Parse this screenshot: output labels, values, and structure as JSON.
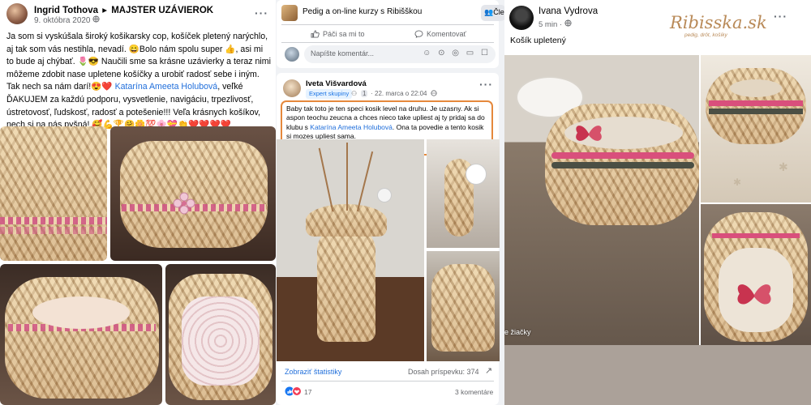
{
  "post1": {
    "author": "Ingrid Tothova",
    "arrow": "▸",
    "group": "MAJSTER UZÁVIEROK",
    "date": "9. októbra 2020",
    "text_a": "Ja som si vyskúšala široký košikarsky cop, košíček pletený narýchlo, aj tak som vás nestihla, nevadí. 😄Bolo nám spolu super 👍, asi mi to bude aj chýbať. 🌷😎 Naučili sme sa krásne uzávierky a teraz  nimi môžeme zdobit nase upletene košíčky a urobiť radosť sebe i iným. Tak nech sa nám darí!😍❤️ ",
    "link": "Katarína Ameeta Holubová",
    "text_b": ", veľké ĎAKUJEM za každú podporu, vysvetlenie, navigáciu, trpezlivosť, ústretovosť, ľudskosť, radosť a potešenie!!! Veľa krásnych košíkov, nech si na nás pyšná! 🥰💪🏆🤗🌼💯🌸💝👏❤️❤️❤️❤️"
  },
  "post2": {
    "group_name": "Pedig a on-line kurzy s Ribišškou",
    "group_btn": "Čle",
    "like_label": "Páči sa mi to",
    "comment_label": "Komentovať",
    "comment_placeholder": "Napíšte komentár...",
    "comment_icons": "☺ ⊙ ◎ ▭ ☐",
    "author": "Iveta Višvardová",
    "badge": "Expert skupiny",
    "number": "1",
    "date": "22. marca o 22:04",
    "text_a": "Baby tak toto je ten speci kosik level na druhu. Je uzasny. Ak si aspon teochu zeucna a chces nieco take upliest aj ty pridaj sa do klubu s ",
    "link": "Katarína Ameeta Holubová",
    "text_b": ". Ona ta povedie a tento kosik si mozes upliest sama.",
    "stats_label": "Zobraziť štatistiky",
    "reach_label": "Dosah príspevku: 374",
    "reactions": "17",
    "comments": "3 komentáre"
  },
  "post3": {
    "author": "Ivana Vydrova",
    "time": "5 min",
    "logo": "Ribisska.sk",
    "logo_tagline": "pedig, drôt, košíky",
    "caption": "Košík upletený",
    "overlay_text": "e žiačky"
  },
  "colors": {
    "link": "#216fdb",
    "highlight_border": "#e5883c",
    "muted": "#65676b",
    "brand_logo": "#b98a58"
  }
}
